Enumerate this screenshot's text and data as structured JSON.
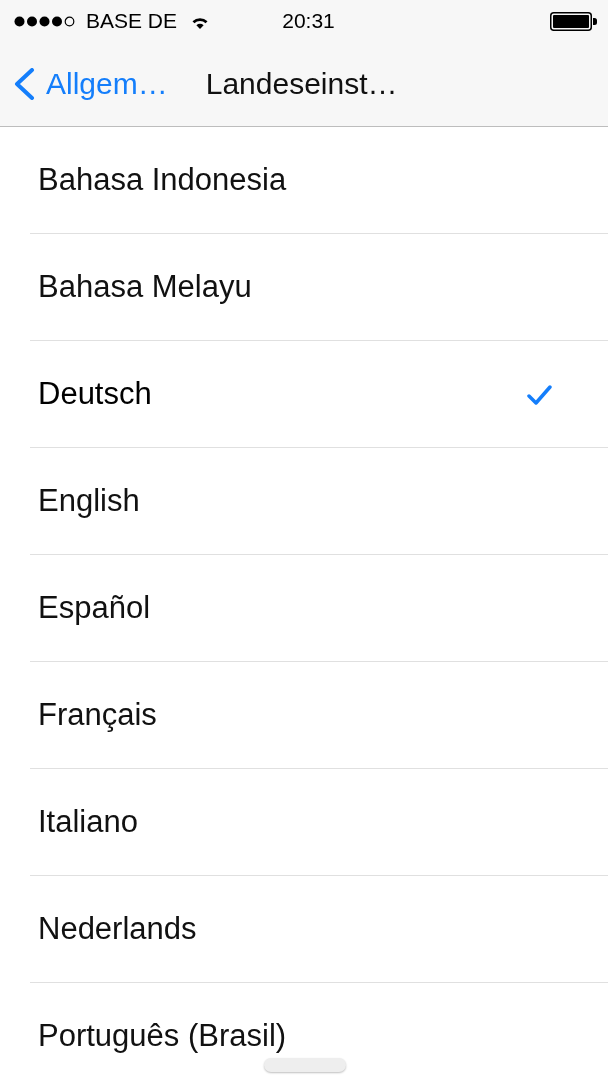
{
  "status_bar": {
    "carrier": "BASE DE",
    "time": "20:31"
  },
  "nav_bar": {
    "back": "Allgem…",
    "title": "Landeseinst…"
  },
  "languages": [
    {
      "label": "Bahasa Indonesia",
      "selected": false
    },
    {
      "label": "Bahasa Melayu",
      "selected": false
    },
    {
      "label": "Deutsch",
      "selected": true
    },
    {
      "label": "English",
      "selected": false
    },
    {
      "label": "Español",
      "selected": false
    },
    {
      "label": "Français",
      "selected": false
    },
    {
      "label": "Italiano",
      "selected": false
    },
    {
      "label": "Nederlands",
      "selected": false
    },
    {
      "label": "Português (Brasil)",
      "selected": false
    }
  ]
}
